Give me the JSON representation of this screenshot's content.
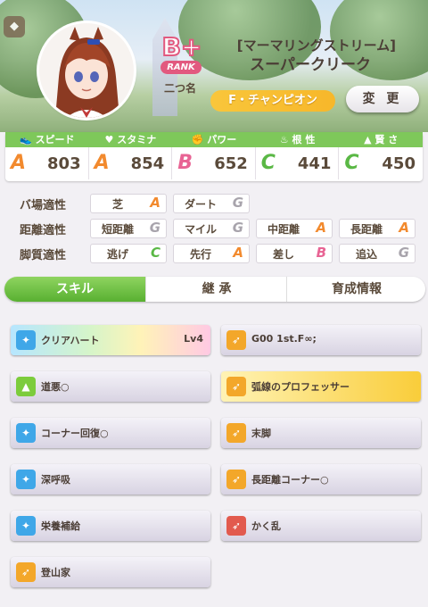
{
  "header": {
    "back_icon": "pin-icon",
    "rank": {
      "letter": "B+",
      "label": "RANK"
    },
    "nickname": "二つ名",
    "title_line1": "[マーマリングストリーム]",
    "title_line2": "スーパークリーク",
    "epithet": "F・チャンピオン",
    "change_label": "変 更"
  },
  "stats": [
    {
      "name": "スピード",
      "icon": "shoe-icon",
      "grade": "A",
      "value": "803",
      "color": "#f28a2e"
    },
    {
      "name": "スタミナ",
      "icon": "heart-icon",
      "grade": "A",
      "value": "854",
      "color": "#f28a2e"
    },
    {
      "name": "パワー",
      "icon": "muscle-icon",
      "grade": "B",
      "value": "652",
      "color": "#e86494"
    },
    {
      "name": "根 性",
      "icon": "flame-icon",
      "grade": "C",
      "value": "441",
      "color": "#5ab845"
    },
    {
      "name": "賢 さ",
      "icon": "cap-icon",
      "grade": "C",
      "value": "450",
      "color": "#5ab845"
    }
  ],
  "aptitudes": {
    "track": {
      "label": "バ場適性",
      "items": [
        {
          "name": "芝",
          "grade": "A"
        },
        {
          "name": "ダート",
          "grade": "G"
        }
      ]
    },
    "distance": {
      "label": "距離適性",
      "items": [
        {
          "name": "短距離",
          "grade": "G"
        },
        {
          "name": "マイル",
          "grade": "G"
        },
        {
          "name": "中距離",
          "grade": "A"
        },
        {
          "name": "長距離",
          "grade": "A"
        }
      ]
    },
    "style": {
      "label": "脚質適性",
      "items": [
        {
          "name": "逃げ",
          "grade": "C"
        },
        {
          "name": "先行",
          "grade": "A"
        },
        {
          "name": "差し",
          "grade": "B"
        },
        {
          "name": "追込",
          "grade": "G"
        }
      ]
    }
  },
  "grade_colors": {
    "A": "#f28a2e",
    "B": "#e86494",
    "C": "#5ab845",
    "G": "#a8a4ac"
  },
  "tabs": [
    "スキル",
    "継 承",
    "育成情報"
  ],
  "skills": [
    {
      "name": "クリアハート",
      "level": "Lv4",
      "icon": "sparkle-icon",
      "style": "rainbow",
      "icon_color": "#3fa7e8"
    },
    {
      "name": "G00 1st.F∞;",
      "level": "",
      "icon": "runner-icon",
      "style": "normal",
      "icon_color": "#f3a72a"
    },
    {
      "name": "道悪○",
      "level": "",
      "icon": "boot-icon",
      "style": "normal",
      "icon_color": "#7ccc3c"
    },
    {
      "name": "弧線のプロフェッサー",
      "level": "",
      "icon": "runner-icon",
      "style": "gold",
      "icon_color": "#f3a72a"
    },
    {
      "name": "コーナー回復○",
      "level": "",
      "icon": "sparkle-icon",
      "style": "normal",
      "icon_color": "#3fa7e8"
    },
    {
      "name": "末脚",
      "level": "",
      "icon": "runner-icon",
      "style": "normal",
      "icon_color": "#f3a72a"
    },
    {
      "name": "深呼吸",
      "level": "",
      "icon": "sparkle-icon",
      "style": "normal",
      "icon_color": "#3fa7e8"
    },
    {
      "name": "長距離コーナー○",
      "level": "",
      "icon": "runner-icon",
      "style": "normal",
      "icon_color": "#f3a72a"
    },
    {
      "name": "栄養補給",
      "level": "",
      "icon": "sparkle-icon",
      "style": "normal",
      "icon_color": "#3fa7e8"
    },
    {
      "name": "かく乱",
      "level": "",
      "icon": "runner-red-icon",
      "style": "normal",
      "icon_color": "#e25a4e"
    },
    {
      "name": "登山家",
      "level": "",
      "icon": "runner-icon",
      "style": "normal",
      "icon_color": "#f3a72a"
    }
  ]
}
